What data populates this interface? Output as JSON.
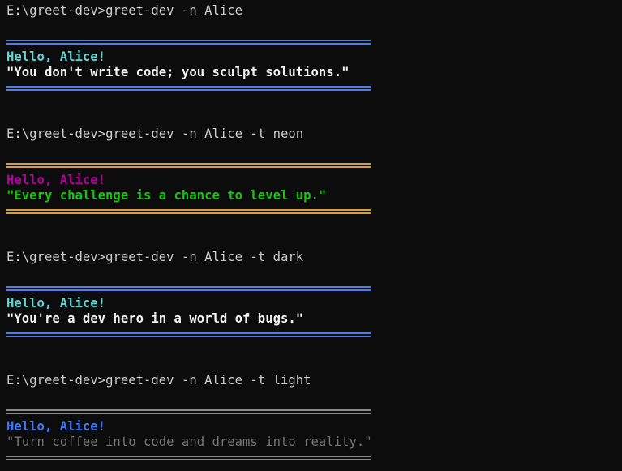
{
  "prompt": "E:\\greet-dev>",
  "sessions": [
    {
      "command": "greet-dev -n Alice",
      "greeting": "Hello, Alice!",
      "quote": "\"You don't write code; you sculpt solutions.\"",
      "colors": {
        "rule": "#4f7fe6",
        "greeting": "#61d6d6",
        "quote": "#f2f2f2"
      }
    },
    {
      "command": "greet-dev -n Alice -t neon",
      "greeting": "Hello, Alice!",
      "quote": "\"Every challenge is a chance to level up.\"",
      "colors": {
        "rule": "#d4a03a",
        "greeting": "#b4009e",
        "quote": "#16c60c"
      }
    },
    {
      "command": "greet-dev -n Alice -t dark",
      "greeting": "Hello, Alice!",
      "quote": "\"You're a dev hero in a world of bugs.\"",
      "colors": {
        "rule": "#4f7fe6",
        "greeting": "#61d6d6",
        "quote": "#f2f2f2"
      }
    },
    {
      "command": "greet-dev -n Alice -t light",
      "greeting": "Hello, Alice!",
      "quote": "\"Turn coffee into code and dreams into reality.\"",
      "colors": {
        "rule": "#8a8a8a",
        "greeting": "#3b78ff",
        "quote": "#767676"
      }
    }
  ]
}
